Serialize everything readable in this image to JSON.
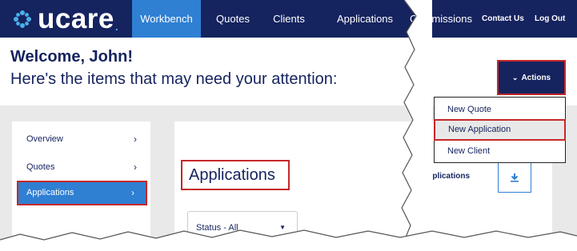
{
  "brand": {
    "name": "ucare",
    "dot": "."
  },
  "nav": {
    "items": [
      {
        "label": "Workbench"
      },
      {
        "label": "Quotes"
      },
      {
        "label": "Clients"
      },
      {
        "label": "Applications"
      },
      {
        "label": "Commissions"
      }
    ],
    "contact": "Contact Us",
    "logout": "Log Out"
  },
  "header": {
    "welcome": "Welcome, John!",
    "subtitle": "Here's the items that may need your attention:"
  },
  "actions": {
    "label": "Actions",
    "menu": [
      "New Quote",
      "New Application",
      "New Client"
    ]
  },
  "sidebar": {
    "items": [
      {
        "label": "Overview"
      },
      {
        "label": "Quotes"
      },
      {
        "label": "Applications"
      }
    ]
  },
  "main": {
    "title": "Applications",
    "status_filter": "Status - All",
    "panel_label": "Applications"
  },
  "colors": {
    "navy": "#15235f",
    "accent_blue": "#2f7fd3",
    "highlight_red": "#c62828",
    "logo_teal": "#4ab0e8"
  }
}
